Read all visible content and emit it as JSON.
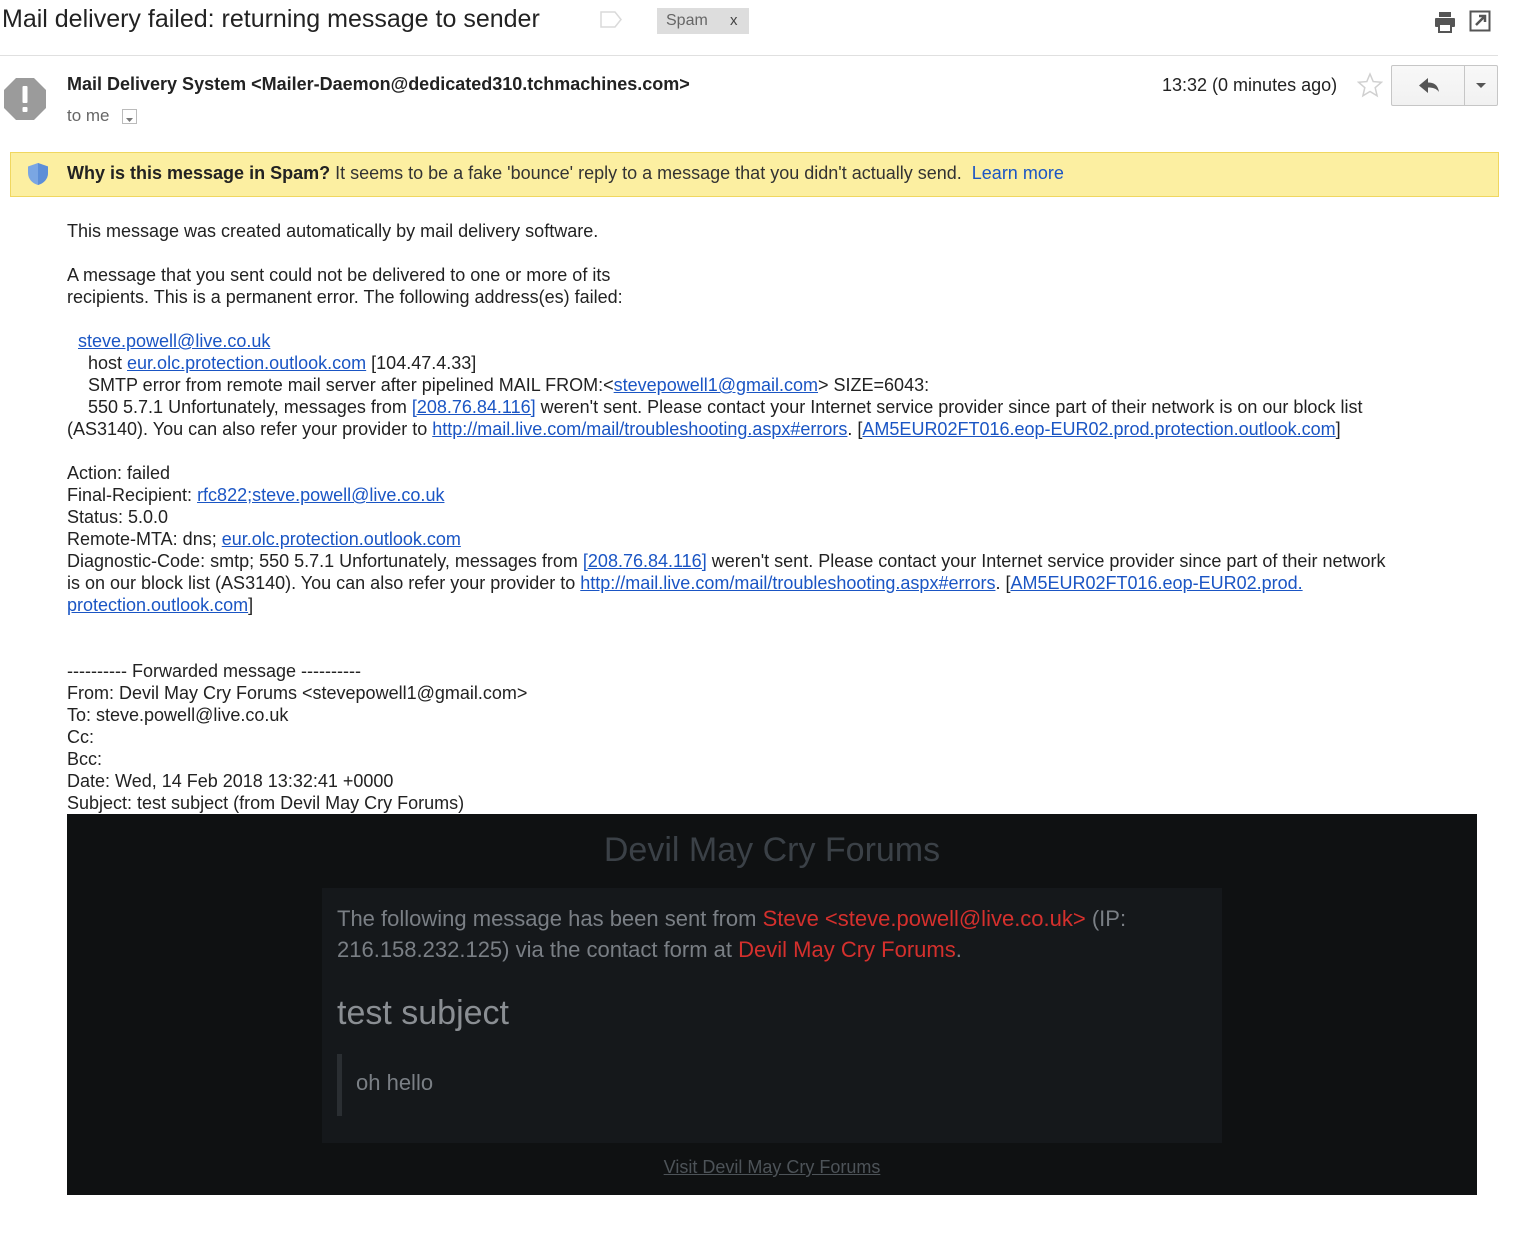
{
  "header": {
    "subject": "Mail delivery failed: returning message to sender",
    "spam_label": "Spam",
    "spam_remove": "x"
  },
  "sender": {
    "display": "Mail Delivery System <Mailer-Daemon@dedicated310.tchmachines.com>",
    "to": "to me",
    "time": "13:32 (0 minutes ago)"
  },
  "spam_banner": {
    "question": "Why is this message in Spam?",
    "explanation": " It seems to be a fake 'bounce' reply to a message that you didn't actually send.",
    "learn_more": "Learn more"
  },
  "body": {
    "intro": "This message was created automatically by mail delivery software.",
    "p2_l1": "A message that you sent could not be delivered to one or more of its",
    "p2_l2": "recipients. This is a permanent error. The following address(es) failed:",
    "failed_address": "steve.powell@live.co.uk",
    "host_prefix": "host ",
    "host_link": "eur.olc.protection.outlook.com",
    "host_ip": " [104.47.4.33]",
    "smtp_prefix": "SMTP error from remote mail server after pipelined MAIL FROM:<",
    "smtp_link": "stevepowell1@gmail.com",
    "smtp_suffix": "> SIZE=6043:",
    "err_prefix": "550 5.7.1 Unfortunately, messages from ",
    "err_ip_link": "[208.76.84.116]",
    "err_suffix": " weren't sent. Please contact your Internet service provider since part of their network is on our block list",
    "err2_prefix": "(AS3140). You can also refer your provider to ",
    "err2_link": "http://mail.live.com/mail/troubleshooting.aspx#errors",
    "err2_mid": ". [",
    "err2_link2": "AM5EUR02FT016.eop-EUR02.prod.protection.outlook.com",
    "err2_end": "]",
    "action": "Action: failed",
    "final_prefix": "Final-Recipient: ",
    "final_link": "rfc822;steve.powell@live.co.uk",
    "status": "Status: 5.0.0",
    "mta_prefix": "Remote-MTA: dns; ",
    "mta_link": "eur.olc.protection.outlook.com",
    "diag_prefix": "Diagnostic-Code: smtp; 550 5.7.1 Unfortunately, messages from ",
    "diag_ip_link": "[208.76.84.116]",
    "diag_suffix": " weren't sent. Please contact your Internet service provider since part of their network",
    "diag2_prefix": "is on our block list (AS3140). You can also refer your provider to ",
    "diag2_link": "http://mail.live.com/mail/troubleshooting.aspx#errors",
    "diag2_mid": ". [",
    "diag2_link2": "AM5EUR02FT016.eop-EUR02.prod.",
    "diag3_link": "protection.outlook.com",
    "diag3_end": "]"
  },
  "forwarded": {
    "separator": "---------- Forwarded message ----------",
    "from": "From: Devil May Cry Forums <stevepowell1@gmail.com>",
    "to": "To: steve.powell@live.co.uk",
    "cc": "Cc:",
    "bcc": "Bcc:",
    "date": "Date: Wed, 14 Feb 2018 13:32:41 +0000",
    "subject": "Subject: test subject (from Devil May Cry Forums)"
  },
  "html_email": {
    "title": "Devil May Cry Forums",
    "msg_prefix": "The following message has been sent from ",
    "msg_sender": "Steve <steve.powell@live.co.uk>",
    "msg_mid": " (IP: 216.158.232.125) via the contact form at ",
    "msg_site": "Devil May Cry Forums",
    "msg_end": ".",
    "subject": "test subject",
    "body": "oh hello",
    "visit_link": "Visit Devil May Cry Forums"
  },
  "colors": {
    "link": "#1a55c4",
    "spam_banner_bg": "#fcefa1",
    "accent_red": "#d5302d",
    "html_panel_bg": "#0f1112"
  },
  "icons": [
    "tag-icon",
    "print-icon",
    "new-window-icon",
    "spam-avatar-icon",
    "dropdown-icon",
    "star-icon",
    "reply-icon",
    "chevron-down-icon",
    "shield-icon"
  ]
}
